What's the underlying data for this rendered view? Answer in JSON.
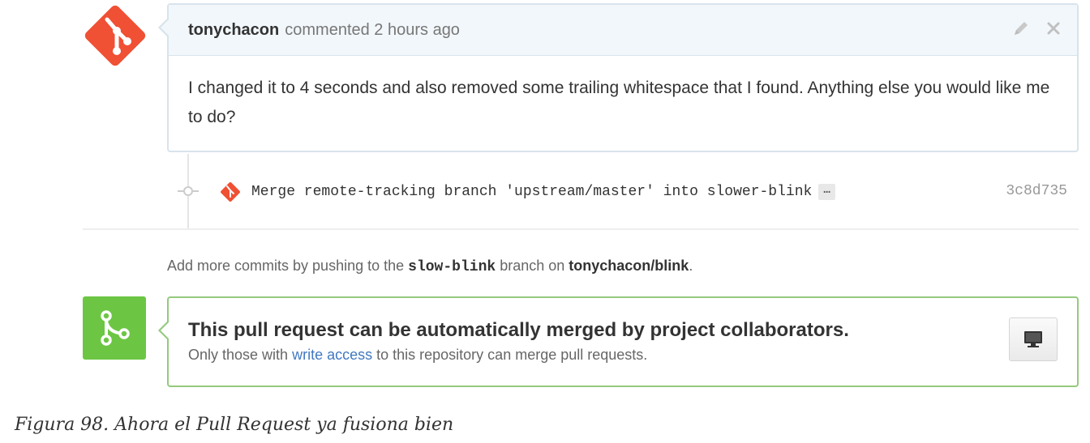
{
  "comment": {
    "author": "tonychacon",
    "meta": "commented 2 hours ago",
    "body": "I changed it to 4 seconds and also removed some trailing whitespace that I found. Anything else you would like me to do?",
    "edit_icon": "pencil-icon",
    "close_icon": "close-icon"
  },
  "commit": {
    "message": "Merge remote-tracking branch 'upstream/master' into slower-blink",
    "ellipsis": "…",
    "sha": "3c8d735"
  },
  "push_hint": {
    "prefix": "Add more commits by pushing to the",
    "branch": "slow-blink",
    "middle": "branch on",
    "repo": "tonychacon/blink",
    "suffix": "."
  },
  "merge": {
    "title": "This pull request can be automatically merged by project collaborators.",
    "sub_prefix": "Only those with",
    "sub_link": "write access",
    "sub_suffix": "to this repository can merge pull requests.",
    "button_icon": "monitor-icon"
  },
  "caption": "Figura 98. Ahora el Pull Request ya fusiona bien",
  "colors": {
    "git_logo": "#f05033",
    "merge_green": "#6cc644",
    "link": "#4078c0"
  }
}
